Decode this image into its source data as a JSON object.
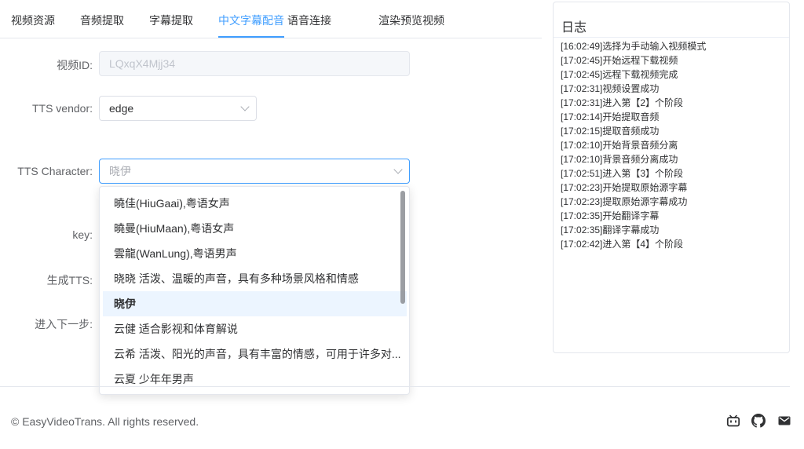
{
  "tabs": [
    {
      "label": "视频资源"
    },
    {
      "label": "音频提取"
    },
    {
      "label": "字幕提取"
    },
    {
      "label": "中文字幕配音"
    },
    {
      "label": "语音连接"
    },
    {
      "label": "渲染预览视频"
    }
  ],
  "active_tab": "中文字幕配音",
  "form": {
    "video_id_label": "视频ID:",
    "video_id_value": "LQxqX4Mjj34",
    "tts_vendor_label": "TTS vendor:",
    "tts_vendor_value": "edge",
    "tts_character_label": "TTS Character:",
    "tts_character_placeholder": "晓伊",
    "key_label": "key:",
    "generate_label": "生成TTS:",
    "next_step_label": "进入下一步:"
  },
  "dropdown": {
    "options": [
      "曉佳(HiuGaai),粤语女声",
      "曉曼(HiuMaan),粤语女声",
      "雲龍(WanLung),粤语男声",
      "晓晓 活泼、温暖的声音，具有多种场景风格和情感",
      "晓伊",
      "云健 适合影视和体育解说",
      "云希 活泼、阳光的声音，具有丰富的情感，可用于许多对...",
      "云夏 少年年男声"
    ],
    "selected_index": 4
  },
  "log": {
    "title": "日志",
    "lines": [
      "[16:02:49]选择为手动输入视频模式",
      "[17:02:45]开始远程下载视频",
      "[17:02:45]远程下载视频完成",
      "[17:02:31]视频设置成功",
      "[17:02:31]进入第【2】个阶段",
      "[17:02:14]开始提取音频",
      "[17:02:15]提取音频成功",
      "[17:02:10]开始背景音频分离",
      "[17:02:10]背景音频分离成功",
      "[17:02:51]进入第【3】个阶段",
      "[17:02:23]开始提取原始源字幕",
      "[17:02:23]提取原始源字幕成功",
      "[17:02:35]开始翻译字幕",
      "[17:02:35]翻译字幕成功",
      "[17:02:42]进入第【4】个阶段"
    ]
  },
  "footer": {
    "copyright": "© EasyVideoTrans. All rights reserved.",
    "icons": [
      "bilibili-icon",
      "github-icon",
      "mail-icon"
    ]
  },
  "colors": {
    "accent": "#409eff",
    "selected_bg": "#ecf5ff",
    "border": "#dcdfe6"
  }
}
